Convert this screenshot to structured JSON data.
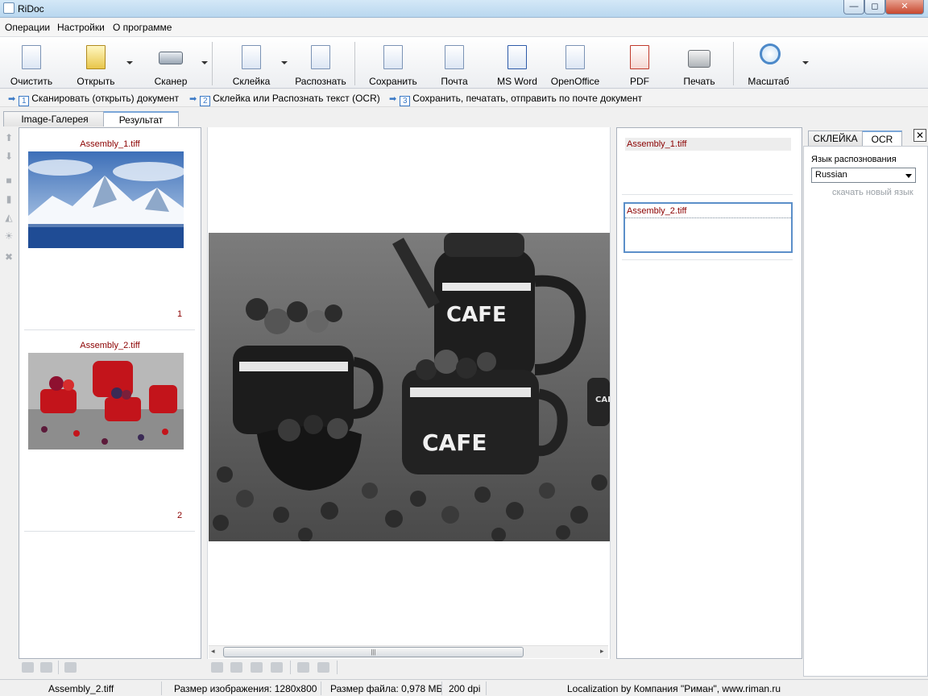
{
  "window": {
    "title": "RiDoc",
    "controls": {
      "minimize": "—",
      "maximize": "◻",
      "close": "✕"
    }
  },
  "menu": [
    "Операции",
    "Настройки",
    "О программе"
  ],
  "toolbar": [
    {
      "label": "Очистить",
      "icon": "blank-page-icon"
    },
    {
      "label": "Открыть",
      "icon": "open-folder-icon"
    },
    {
      "label": "Сканер",
      "icon": "scanner-icon"
    },
    {
      "label": "Склейка",
      "icon": "glue-pages-icon"
    },
    {
      "label": "Распознать",
      "icon": "recognize-icon"
    },
    {
      "label": "Сохранить",
      "icon": "save-disk-icon"
    },
    {
      "label": "Почта",
      "icon": "mail-icon"
    },
    {
      "label": "MS Word",
      "icon": "word-document-icon"
    },
    {
      "label": "OpenOffice",
      "icon": "openoffice-document-icon"
    },
    {
      "label": "PDF",
      "icon": "pdf-document-icon"
    },
    {
      "label": "Печать",
      "icon": "printer-icon"
    },
    {
      "label": "Масштаб",
      "icon": "magnifier-icon"
    }
  ],
  "steps": [
    {
      "num": "1",
      "text": "Сканировать (открыть) документ"
    },
    {
      "num": "2",
      "text": "Склейка или Распознать текст (OCR)"
    },
    {
      "num": "3",
      "text": "Сохранить, печатать, отправить по почте документ"
    }
  ],
  "left_tabs": [
    "Image-Галерея",
    "Результат"
  ],
  "gallery": [
    {
      "name": "Assembly_1.tiff",
      "num": "1"
    },
    {
      "name": "Assembly_2.tiff",
      "num": "2"
    }
  ],
  "preview_text": {
    "cafe1": "CAFE",
    "cafe2": "CAFE",
    "cafe3": "CAFE"
  },
  "text_panel": [
    "Assembly_1.tiff",
    "Assembly_2.tiff"
  ],
  "right_tabs": [
    "СКЛЕЙКА",
    "OCR"
  ],
  "ocr": {
    "lang_label": "Язык распознования",
    "lang_value": "Russian",
    "download_link": "скачать новый язык",
    "close": "✕"
  },
  "status": {
    "file": "Assembly_2.tiff",
    "image_size": "Размер изображения: 1280x800",
    "file_size": "Размер файла: 0,978 МБ",
    "dpi": "200 dpi",
    "localization": "Localization by Компания \"Риман\", www.riman.ru"
  },
  "colors": {
    "filename": "#8b0000",
    "accent": "#3a79c6",
    "mug_red": "#c3141b"
  }
}
